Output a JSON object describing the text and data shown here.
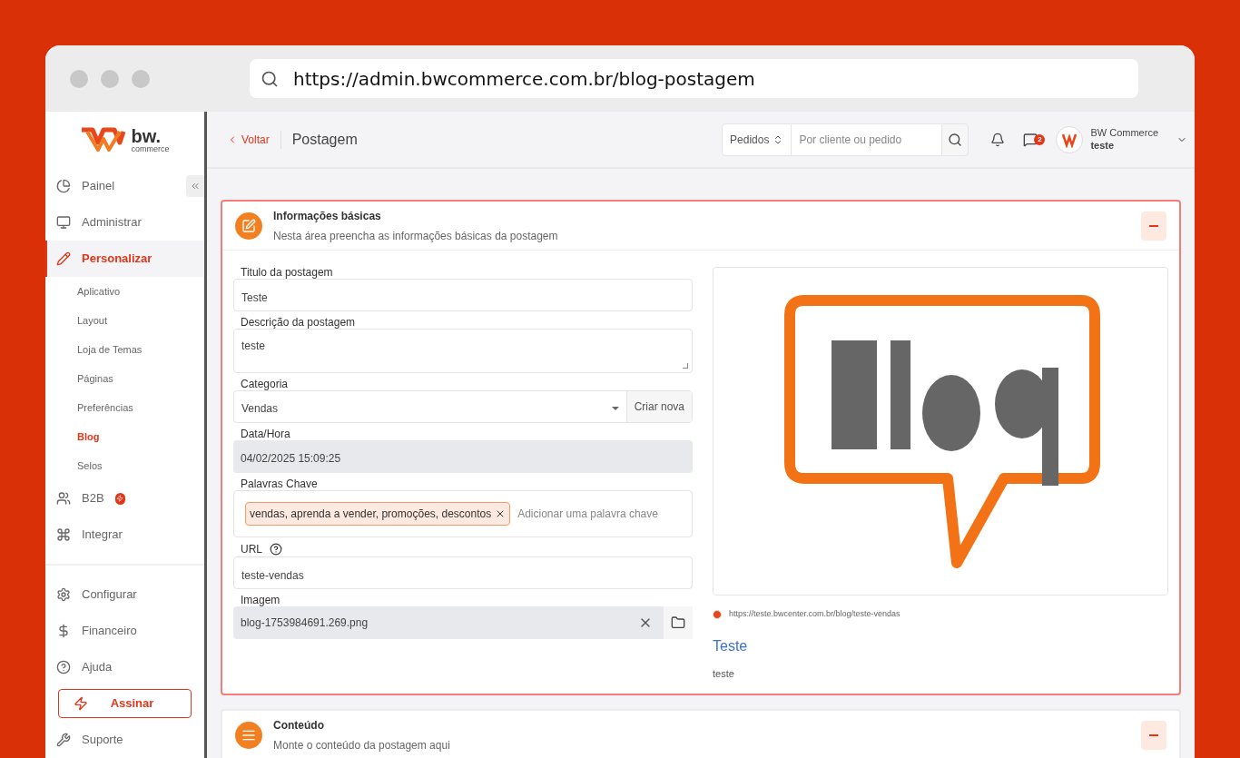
{
  "browser": {
    "url": "https://admin.bwcommerce.com.br/blog-postagem"
  },
  "logo": {
    "name": "bw.",
    "tagline": "commerce"
  },
  "sidebar": {
    "items": [
      {
        "kind": "main",
        "label": "Painel",
        "selected": false
      },
      {
        "kind": "main",
        "label": "Administrar",
        "selected": false
      },
      {
        "kind": "main",
        "label": "Personalizar",
        "selected": true
      },
      {
        "kind": "sub",
        "label": "Aplicativo",
        "selected": false
      },
      {
        "kind": "sub",
        "label": "Layout",
        "selected": false
      },
      {
        "kind": "sub",
        "label": "Loja de Temas",
        "selected": false
      },
      {
        "kind": "sub",
        "label": "Páginas",
        "selected": false
      },
      {
        "kind": "sub",
        "label": "Preferências",
        "selected": false
      },
      {
        "kind": "sub",
        "label": "Blog",
        "selected": true
      },
      {
        "kind": "sub",
        "label": "Selos",
        "selected": false
      },
      {
        "kind": "main",
        "label": "B2B",
        "selected": false,
        "badge": true
      },
      {
        "kind": "main",
        "label": "Integrar",
        "selected": false
      },
      {
        "kind": "divider"
      },
      {
        "kind": "main",
        "label": "Configurar",
        "selected": false
      },
      {
        "kind": "main",
        "label": "Financeiro",
        "selected": false
      },
      {
        "kind": "main",
        "label": "Ajuda",
        "selected": false
      },
      {
        "kind": "cta",
        "label": "Assinar"
      },
      {
        "kind": "main",
        "label": "Suporte",
        "selected": false
      }
    ]
  },
  "header": {
    "back": "Voltar",
    "title": "Postagem",
    "search_scope": "Pedidos",
    "search": {
      "placeholder": "Por cliente ou pedido"
    },
    "messages_count": "2",
    "user": {
      "name": "BW Commerce",
      "store": "teste"
    }
  },
  "sections": [
    {
      "title": "Informações básicas",
      "subtitle": "Nesta área preencha as informações básicas da postagem",
      "expanded": true,
      "fields": [
        {
          "kind": "text",
          "label": "Titulo da postagem",
          "value": "Teste"
        },
        {
          "kind": "textarea",
          "label": "Descrição da postagem",
          "value": "teste"
        },
        {
          "kind": "select",
          "label": "Categoria",
          "value": "Vendas",
          "action": "Criar nova"
        },
        {
          "kind": "readonly",
          "label": "Data/Hora",
          "value": "04/02/2025 15:09:25"
        },
        {
          "kind": "tags",
          "label": "Palavras Chave",
          "tags": [
            "vendas, aprenda a vender, promoções, descontos"
          ],
          "placeholder": "Adicionar uma palavra chave"
        },
        {
          "kind": "help",
          "label": "URL",
          "value": "teste-vendas"
        },
        {
          "kind": "file",
          "label": "Imagem",
          "value": "blog-1753984691.269.png"
        }
      ],
      "preview": {
        "link": "https://teste.bwcenter.com.br/blog/teste-vendas",
        "title": "Teste",
        "description": "teste"
      }
    },
    {
      "title": "Conteúdo",
      "subtitle": "Monte o conteúdo da postagem aqui",
      "expanded": true
    }
  ]
}
